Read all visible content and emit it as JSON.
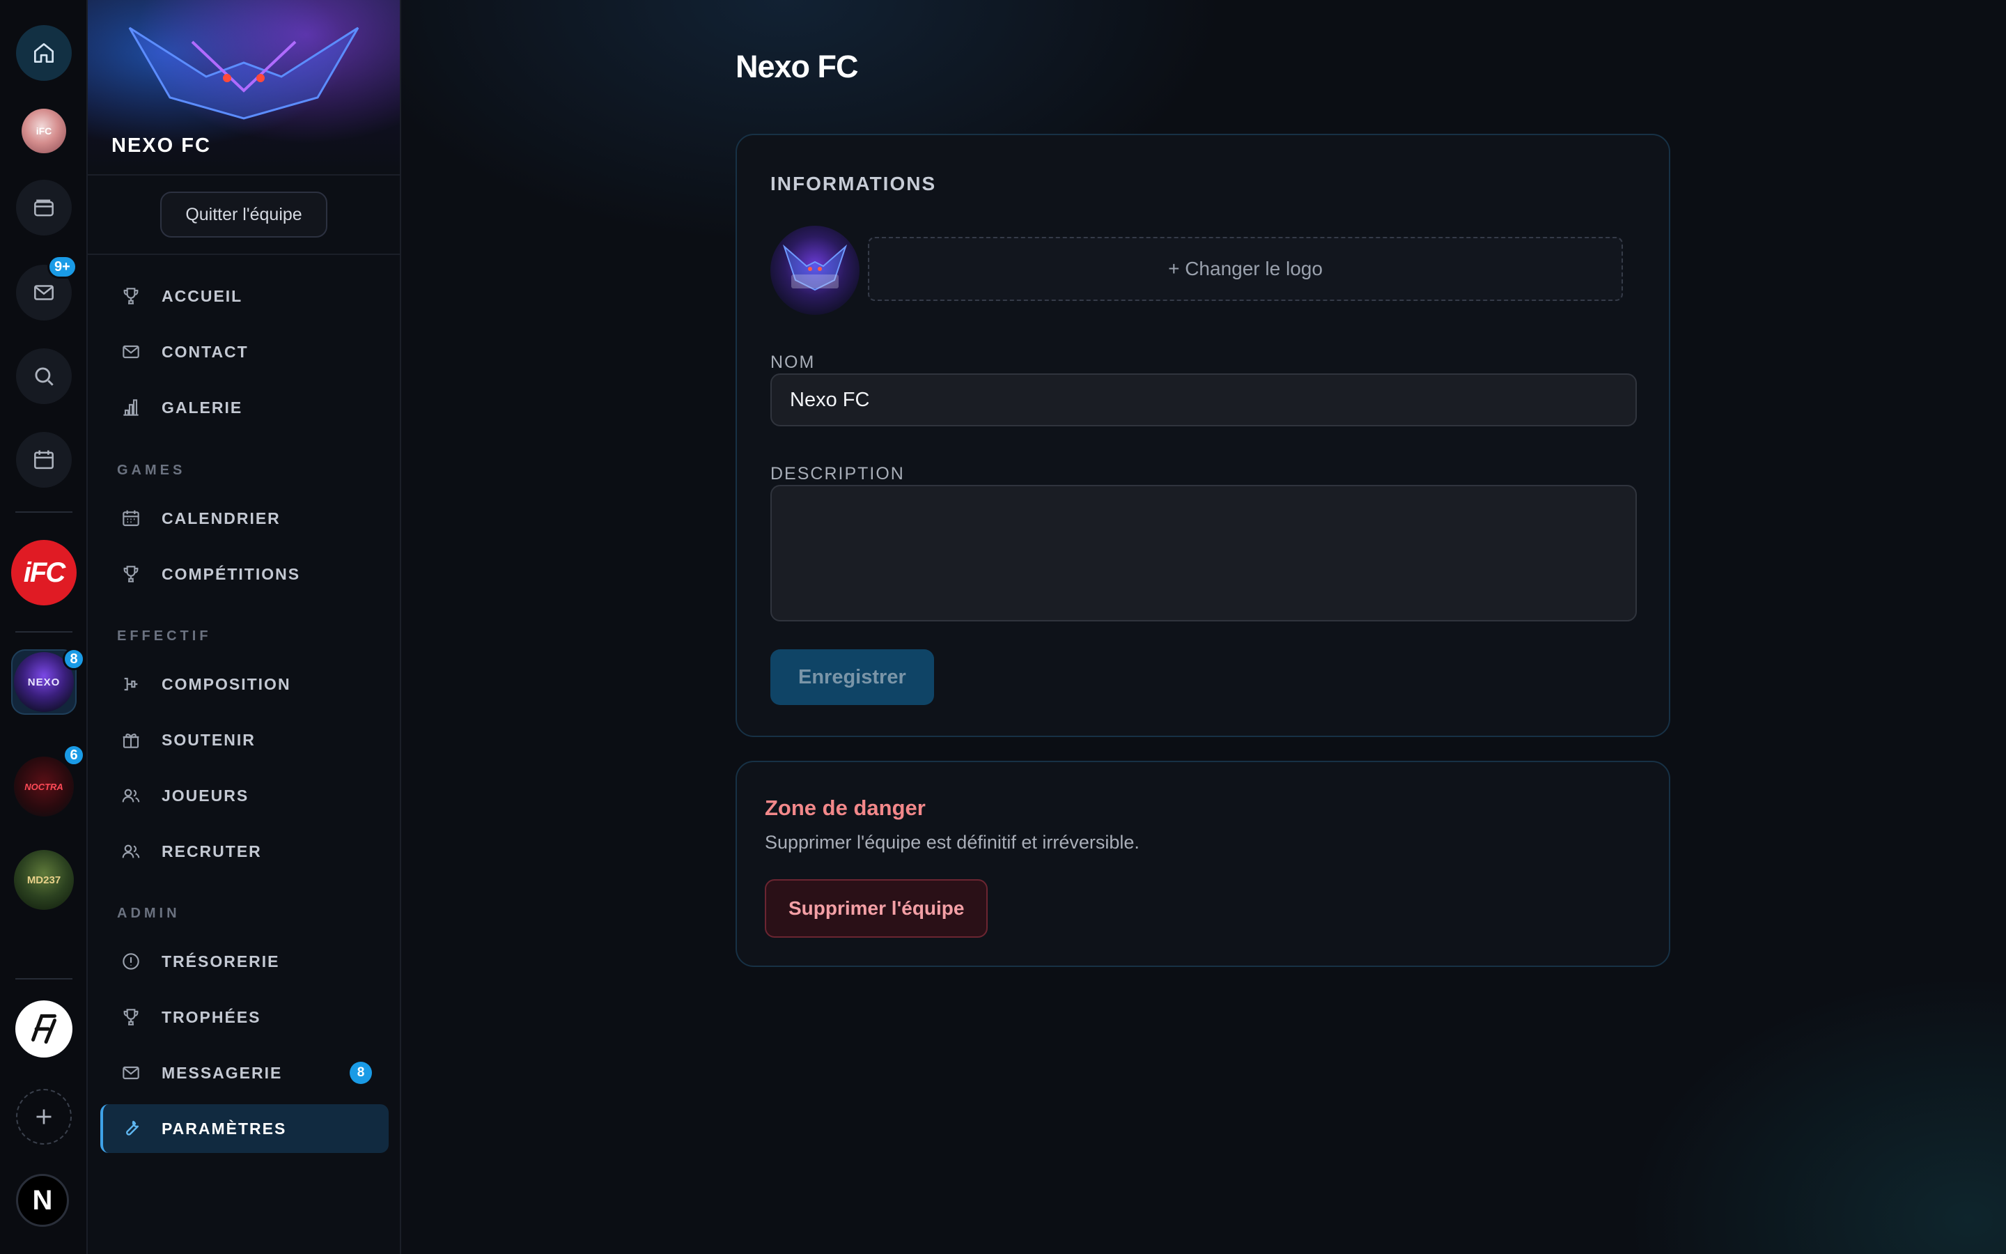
{
  "rail": {
    "home_icon": "home-icon",
    "wallet_icon": "wallet-icon",
    "mail_icon": "mail-icon",
    "mail_badge": "9+",
    "search_icon": "search-icon",
    "calendar_icon": "calendar-icon",
    "ifc_logo_text": "iFC",
    "teams": [
      {
        "name": "NEXO",
        "badge": "8"
      },
      {
        "name": "NOCTRA",
        "badge": "6"
      },
      {
        "name": "MD237",
        "badge": null
      }
    ],
    "user_initial": "N"
  },
  "team": {
    "banner_name": "NEXO FC",
    "leave_label": "Quitter l'équipe"
  },
  "nav": {
    "items_top": [
      {
        "label": "ACCUEIL",
        "icon": "trophy-icon"
      },
      {
        "label": "CONTACT",
        "icon": "mail-icon"
      },
      {
        "label": "GALERIE",
        "icon": "bar-chart-icon"
      }
    ],
    "section_games": "GAMES",
    "items_games": [
      {
        "label": "CALENDRIER",
        "icon": "calendar-icon"
      },
      {
        "label": "COMPÉTITIONS",
        "icon": "trophy-icon"
      }
    ],
    "section_effectif": "EFFECTIF",
    "items_effectif": [
      {
        "label": "COMPOSITION",
        "icon": "lineup-icon"
      },
      {
        "label": "SOUTENIR",
        "icon": "gift-icon"
      },
      {
        "label": "JOUEURS",
        "icon": "users-icon"
      },
      {
        "label": "RECRUTER",
        "icon": "users-icon"
      }
    ],
    "section_admin": "ADMIN",
    "items_admin": [
      {
        "label": "TRÉSORERIE",
        "icon": "coin-icon"
      },
      {
        "label": "TROPHÉES",
        "icon": "trophy-icon"
      },
      {
        "label": "MESSAGERIE",
        "icon": "mail-icon",
        "badge": "8"
      },
      {
        "label": "PARAMÈTRES",
        "icon": "wrench-icon",
        "active": true
      }
    ]
  },
  "main": {
    "title": "Nexo FC",
    "info": {
      "heading": "INFORMATIONS",
      "change_logo_label": "+ Changer le logo",
      "name_label": "NOM",
      "name_value": "Nexo FC",
      "description_label": "DESCRIPTION",
      "description_value": "",
      "save_label": "Enregistrer"
    },
    "danger": {
      "title": "Zone de danger",
      "description": "Supprimer l'équipe est définitif et irréversible.",
      "delete_label": "Supprimer l'équipe"
    }
  },
  "colors": {
    "accent": "#1a9be6",
    "active_bg": "#112a40",
    "danger_text": "#f2888a",
    "danger_bg": "#2a1017"
  }
}
